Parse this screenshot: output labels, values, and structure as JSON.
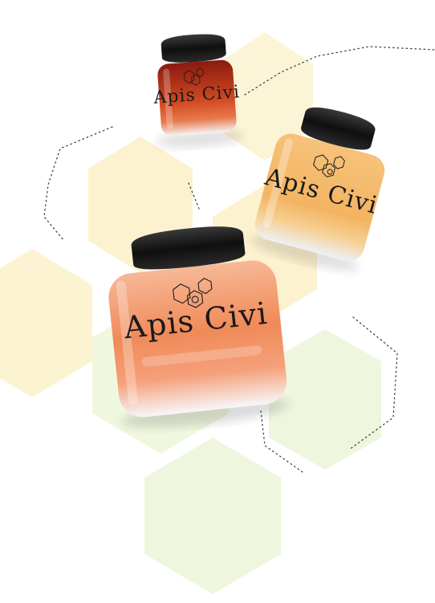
{
  "brand": {
    "name": "Apis Civi"
  },
  "jars": [
    {
      "id": "small",
      "label": "Apis Civi",
      "honey_color": "#c8401c"
    },
    {
      "id": "medium",
      "label": "Apis Civi",
      "honey_color": "#f2b864"
    },
    {
      "id": "large",
      "label": "Apis Civi",
      "honey_color": "#f08a58"
    }
  ],
  "colors": {
    "honeycomb_yellow": "#fbf0c8",
    "honeycomb_green": "#eef6dc",
    "lid": "#1a1a1a",
    "dotted_line": "#444444",
    "background": "#ffffff"
  }
}
